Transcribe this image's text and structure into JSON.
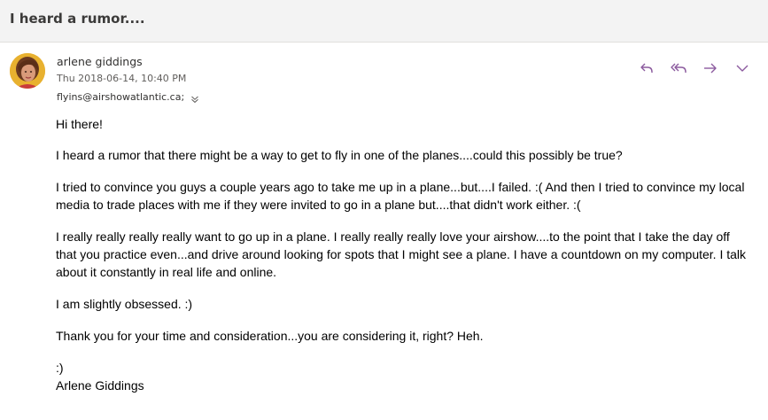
{
  "email": {
    "subject": "I heard a rumor....",
    "sender_name": "arlene giddings",
    "date": "Thu 2018-06-14, 10:40 PM",
    "recipient": "flyins@airshowatlantic.ca;",
    "actions": {
      "reply": "reply-icon",
      "reply_all": "reply-all-icon",
      "forward": "forward-icon",
      "more": "chevron-down-icon"
    },
    "body": {
      "greeting": "Hi there!",
      "p1": "I heard a rumor that there might be a way to get to fly in one of the planes....could this possibly be true?",
      "p2": "I tried to convince you guys a couple years ago to take me up in a plane...but....I failed.  :(  And then I tried to convince my local media to trade places with me if they were invited to go in a plane but....that didn't work either. :(",
      "p3": "I really really really really want to go up in a plane.  I really really really love your airshow....to the point that I take the day off that you practice even...and drive around looking for spots that I might see a plane.  I have a countdown on my computer.  I talk about it constantly in real life and online.",
      "p4": "I am slightly obsessed.  :)",
      "p5": "Thank you for your time and consideration...you are considering it, right?  Heh.",
      "signoff_smiley": ":)",
      "signature": "Arlene Giddings"
    }
  },
  "colors": {
    "accent": "#8b5a9e",
    "background": "#f3f3f3",
    "card": "#ffffff"
  }
}
